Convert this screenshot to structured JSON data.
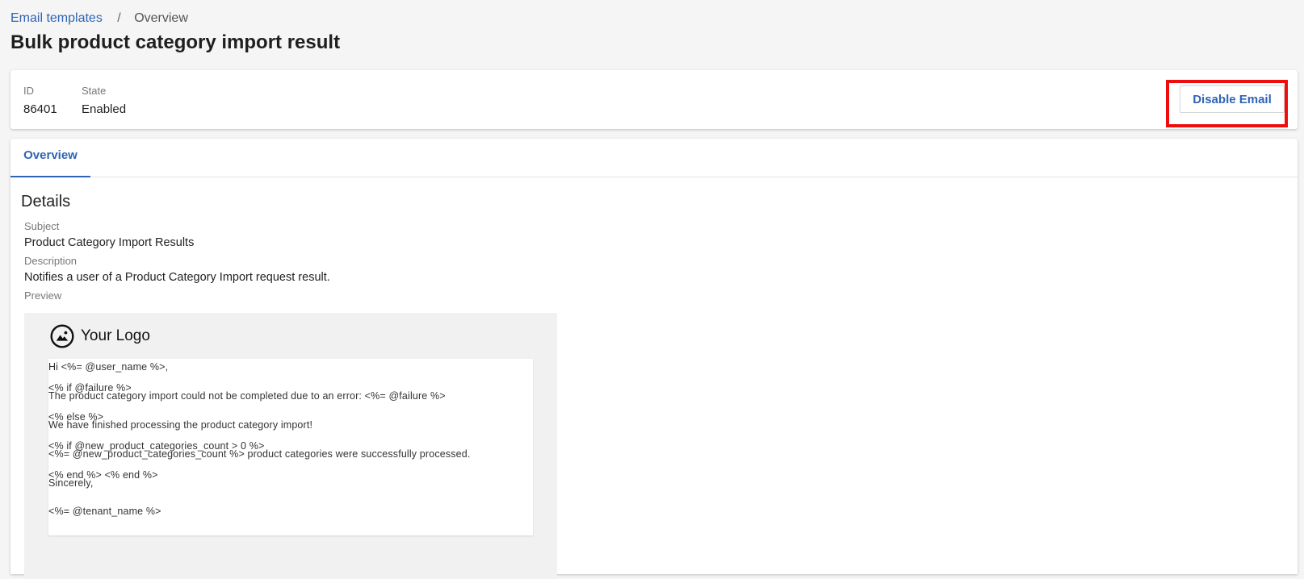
{
  "breadcrumb": {
    "parent": "Email templates",
    "separator": "/",
    "current": "Overview"
  },
  "page_title": "Bulk product category import result",
  "summary": {
    "id_label": "ID",
    "id_value": "86401",
    "state_label": "State",
    "state_value": "Enabled",
    "disable_button": "Disable Email"
  },
  "tabs": [
    {
      "label": "Overview",
      "active": true
    }
  ],
  "details": {
    "heading": "Details",
    "subject_label": "Subject",
    "subject_value": "Product Category Import Results",
    "description_label": "Description",
    "description_value": "Notifies a user of a Product Category Import request result.",
    "preview_label": "Preview"
  },
  "preview": {
    "logo_icon": "image-icon",
    "logo_text": "Your Logo",
    "lines": [
      "Hi <%= @user_name %>,",
      "<% if @failure %>",
      "The product category import could not be completed due to an error: <%= @failure %>",
      "<% else %>",
      "We have finished processing the product category import!",
      "<% if @new_product_categories_count > 0 %>",
      "<%= @new_product_categories_count %> product categories were successfully processed.",
      "<% end %> <% end %>",
      "Sincerely,",
      "<%= @tenant_name %>"
    ]
  },
  "colors": {
    "link": "#2f64b5",
    "highlight": "#ee0c0c",
    "page_background": "#f5f5f5"
  }
}
